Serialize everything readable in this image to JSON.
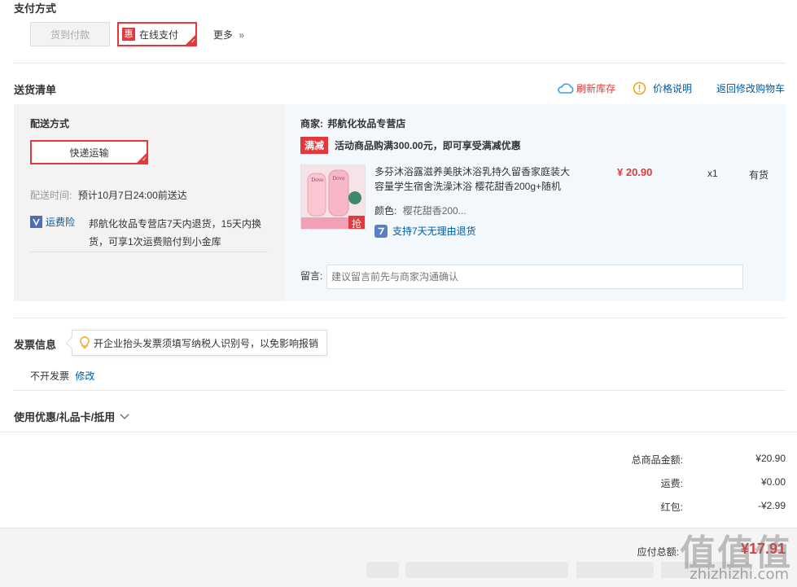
{
  "payment": {
    "title": "支付方式",
    "cod_label": "货到付款",
    "online_badge": "惠",
    "online_label": "在线支付",
    "more_label": "更多",
    "more_icon": "»"
  },
  "delivery": {
    "title": "送货清单",
    "refresh_stock": "刷新库存",
    "price_note": "价格说明",
    "back_to_cart": "返回修改购物车",
    "method_title": "配送方式",
    "method_selected": "快递运输",
    "time_label": "配送时间:",
    "time_value": "预计10月7日24:00前送达",
    "insurance_label": "运费险",
    "insurance_desc_1": "邦航化妆品专营店7天内退货，15天内换",
    "insurance_desc_2": "货，可享1次运费赔付到小金库"
  },
  "shop": {
    "merchant_label": "商家:",
    "merchant_name": "邦航化妆品专营店",
    "promo_tag": "满减",
    "promo_text": "活动商品购满300.00元，即可享受满减优惠",
    "product": {
      "name_line1": "多芬沐浴露滋养美肤沐浴乳持久留香家庭装大",
      "name_line2": "容量学生宿舍洗澡沐浴 樱花甜香200g+随机",
      "price": "¥ 20.90",
      "qty": "x1",
      "stock": "有货",
      "color_label": "颜色:",
      "color_value": "樱花甜香200...",
      "return_policy": "支持7天无理由退货",
      "thumb_brand": "Dove",
      "thumb_tag": "抢"
    },
    "message_label": "留言:",
    "message_placeholder": "建议留言前先与商家沟通确认"
  },
  "invoice": {
    "title": "发票信息",
    "tip": "开企业抬头发票须填写纳税人识别号，以免影响报销",
    "status": "不开发票",
    "edit": "修改"
  },
  "coupon": {
    "title": "使用优惠/礼品卡/抵用"
  },
  "summary": {
    "goods_label": "总商品金额:",
    "goods_value": "¥20.90",
    "shipping_label": "运费:",
    "shipping_value": "¥0.00",
    "redpacket_label": "红包:",
    "redpacket_value": "-¥2.99",
    "total_label": "应付总额:",
    "total_value": "¥17.91"
  },
  "watermark": {
    "main": "值值值",
    "site": "zhizhizhi.com"
  },
  "colors": {
    "accent_red": "#e4393c",
    "link_blue": "#005aa0"
  }
}
